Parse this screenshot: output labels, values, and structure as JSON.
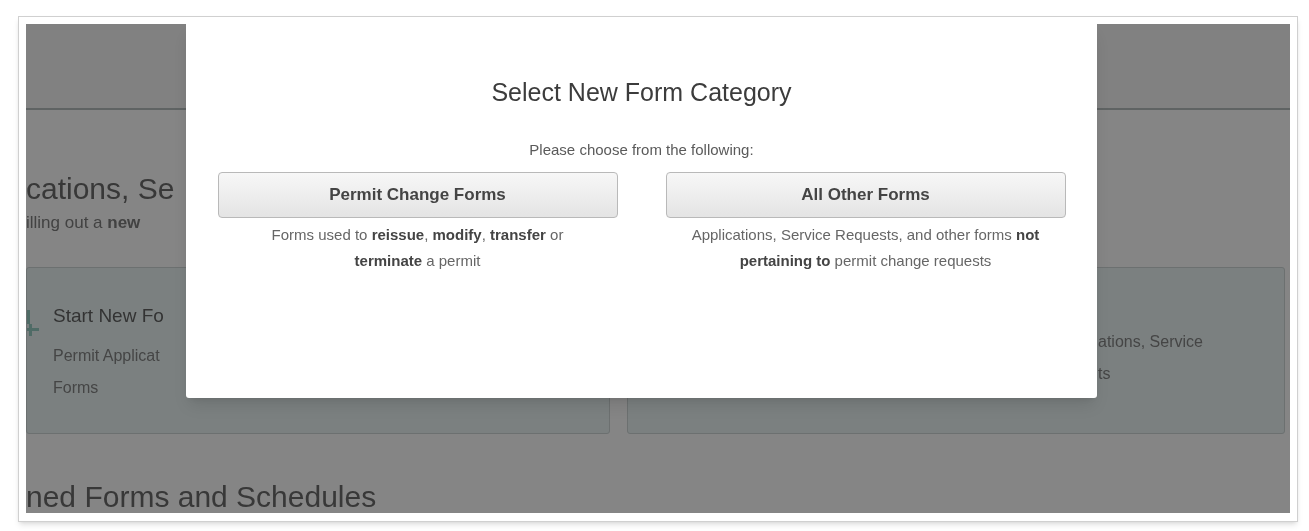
{
  "background": {
    "heading": "cations, Se",
    "subtitle": "illing out a **new**",
    "cards": [
      {
        "title": "Start New Fo",
        "lines": [
          "Permit Applicat",
          "Forms"
        ]
      },
      {
        "lines": [
          "ations, Service",
          "ts"
        ]
      }
    ],
    "section_heading": "ned Forms and Schedules"
  },
  "modal": {
    "title": "Select New Form Category",
    "prompt": "Please choose from the following:",
    "options": [
      {
        "label": "Permit Change Forms",
        "description": "Forms used to **reissue**, **modify**, **transfer** or **terminate** a permit"
      },
      {
        "label": "All Other Forms",
        "description": "Applications, Service Requests, and other forms **not pertaining to** permit change requests"
      }
    ]
  }
}
